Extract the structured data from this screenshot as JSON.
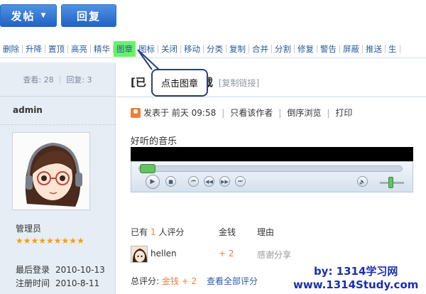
{
  "buttons": {
    "post": "发帖",
    "reply": "回复"
  },
  "toolbar": [
    "删除",
    "升降",
    "置顶",
    "高亮",
    "精华",
    "图章",
    "图标",
    "关闭",
    "移动",
    "分类",
    "复制",
    "合并",
    "分割",
    "修复",
    "警告",
    "屏蔽",
    "推送",
    "生"
  ],
  "toolbar_highlight": "图章",
  "stats": {
    "views": "查看: 28",
    "replies": "回复: 3"
  },
  "author": "admin",
  "rank": "管理员",
  "stars": "★★★★★★★★★",
  "author_info": [
    {
      "label": "最后登录",
      "value": "2010-10-13"
    },
    {
      "label": "注册时间",
      "value": "2010-8-11"
    }
  ],
  "thread": {
    "title_prefix": "[已",
    "title_suffix": "下载",
    "copy_link": "[复制链接]"
  },
  "meta": {
    "posted": "发表于 前天 09:58",
    "only_author": "只看该作者",
    "reverse": "倒序浏览",
    "print": "打印"
  },
  "content": {
    "music_label": "好听的音乐"
  },
  "rating": {
    "header_prefix": "已有",
    "count": "1",
    "header_suffix": "人评分",
    "col_money": "金钱",
    "col_reason": "理由",
    "rows": [
      {
        "user": "hellen",
        "money": "+ 2",
        "reason": "感谢分享"
      }
    ],
    "total_label": "总评分:",
    "total_value": "金钱 + 2",
    "view_all": "查看全部评分"
  },
  "callout": "点击图章",
  "watermark": {
    "line1": "by: 1314学习网",
    "line2": "www.1314Study.com"
  },
  "colors": {
    "accent_blue": "#2163c2",
    "highlight_green": "#66f366",
    "callout_border": "#2b3f7f",
    "rating_orange": "#ef7f3b"
  }
}
